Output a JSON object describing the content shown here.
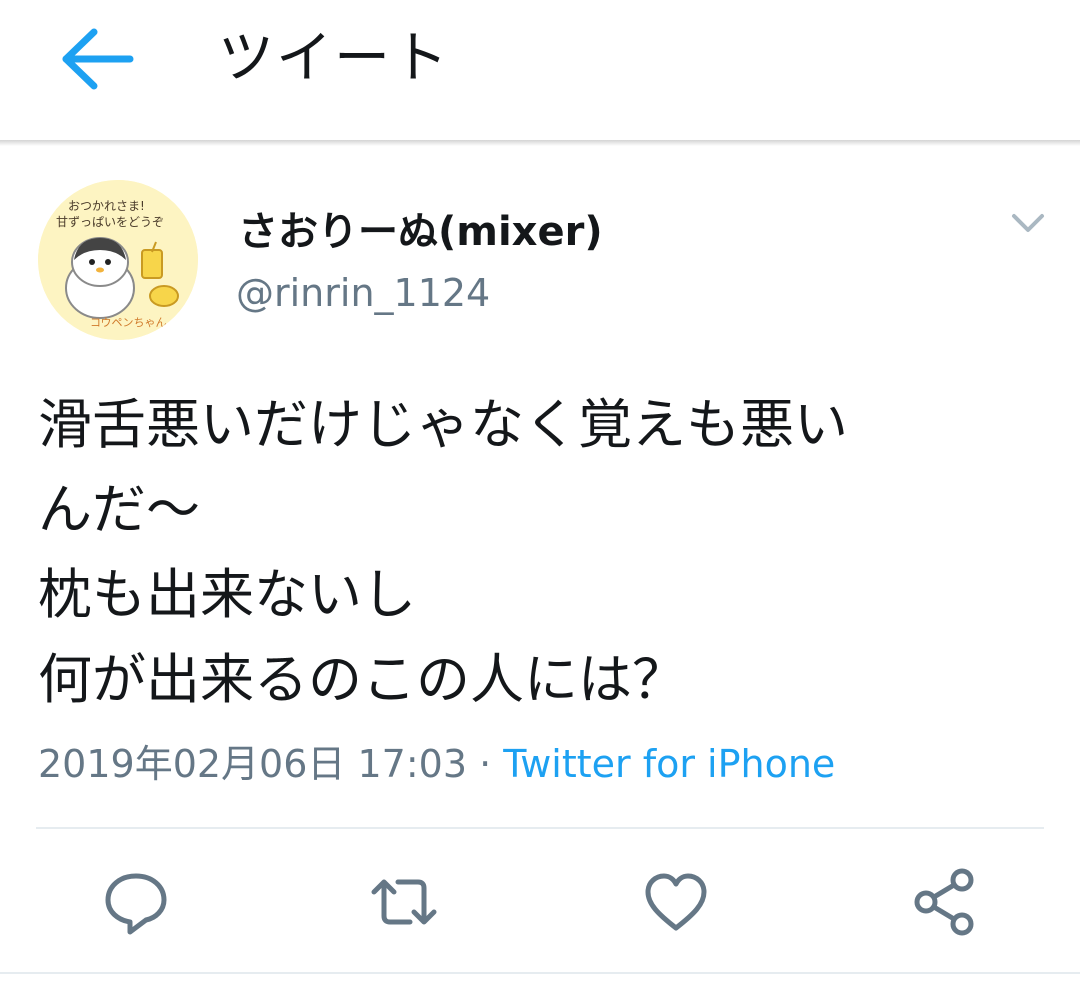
{
  "header": {
    "title": "ツイート",
    "back_icon": "arrow-left-icon"
  },
  "tweet": {
    "avatar": {
      "icon": "penguin-avatar-illustration",
      "text_line1": "おつかれさま!",
      "text_line2": "甘ずっぱいをどうぞ",
      "text_footer": "コウペンちゃん"
    },
    "display_name": "さおりーぬ(mixer)",
    "handle": "@rinrin_1124",
    "text": "滑舌悪いだけじゃなく覚えも悪い\nんだ〜\n枕も出来ないし\n何が出来るのこの人には？",
    "timestamp": "2019年02月06日 17:03",
    "separator": " · ",
    "source": "Twitter for iPhone"
  },
  "actions": [
    {
      "name": "reply",
      "icon": "reply-icon"
    },
    {
      "name": "retweet",
      "icon": "retweet-icon"
    },
    {
      "name": "like",
      "icon": "heart-icon"
    },
    {
      "name": "share",
      "icon": "share-icon"
    }
  ],
  "colors": {
    "accent": "#1da1f2",
    "text": "#14171a",
    "secondary": "#657786",
    "icon": "#657786",
    "divider": "#e6ecf0"
  }
}
